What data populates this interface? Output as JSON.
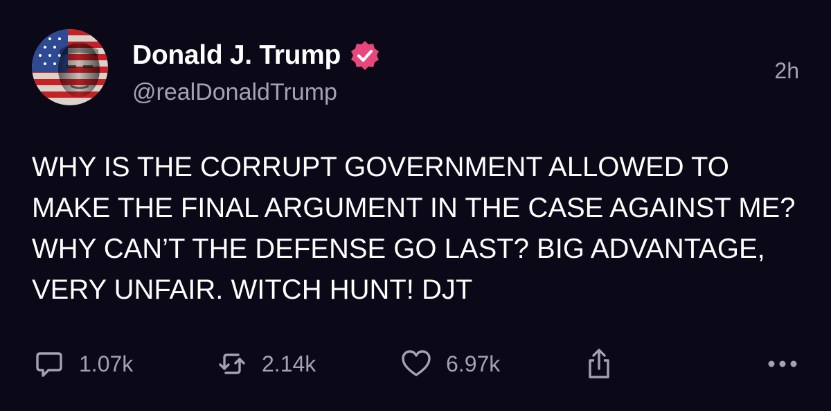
{
  "post": {
    "display_name": "Donald J. Trump",
    "handle": "@realDonaldTrump",
    "time": "2h",
    "verified_icon": "verified-badge-icon",
    "verified_color": "#e8477c",
    "text": "WHY IS THE CORRUPT GOVERNMENT ALLOWED TO MAKE THE FINAL ARGUMENT IN THE CASE AGAINST ME? WHY CAN’T THE DEFENSE GO LAST? BIG ADVANTAGE, VERY UNFAIR. WITCH HUNT! DJT"
  },
  "actions": {
    "reply": {
      "icon": "reply-icon",
      "count": "1.07k"
    },
    "repost": {
      "icon": "repost-icon",
      "count": "2.14k"
    },
    "like": {
      "icon": "heart-icon",
      "count": "6.97k"
    },
    "share": {
      "icon": "share-icon"
    },
    "more": {
      "icon": "more-dots-icon"
    }
  },
  "colors": {
    "background": "#0b0818",
    "primary_text": "#ffffff",
    "secondary_text": "#a5a3b2"
  }
}
